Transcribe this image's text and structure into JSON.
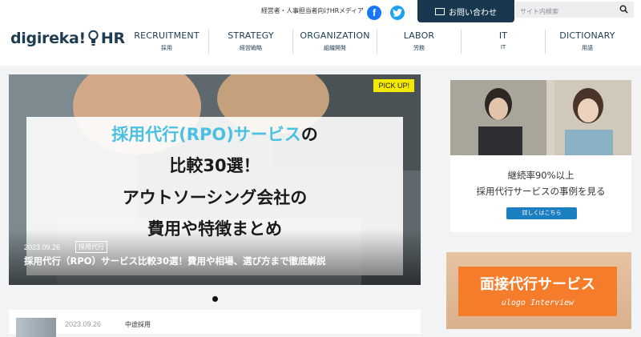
{
  "header": {
    "tagline": "経営者・人事担当者向けHRメディア",
    "facebook_icon": "f",
    "contact_label": "お問い合わせ",
    "search_placeholder": "サイト内検索",
    "logo_left": "digireka!",
    "logo_right": "HR"
  },
  "nav": [
    {
      "en": "RECRUITMENT",
      "jp": "採用"
    },
    {
      "en": "STRATEGY",
      "jp": "経営戦略"
    },
    {
      "en": "ORGANIZATION",
      "jp": "組織開発"
    },
    {
      "en": "LABOR",
      "jp": "労務"
    },
    {
      "en": "IT",
      "jp": "IT"
    },
    {
      "en": "DICTIONARY",
      "jp": "用語"
    }
  ],
  "hero": {
    "badge": "PICK UP!",
    "banner_line1_highlight": "採用代行(RPO)サービス",
    "banner_line1_rest": "の",
    "banner_line2": "比較30選！",
    "banner_line3": "アウトソーシング会社の",
    "banner_line4": "費用や特徴まとめ",
    "date": "2023.09.26",
    "category": "採用代行",
    "title": "採用代行（RPO）サービス比較30選！費用や相場、選び方まで徹底解説"
  },
  "sidebar_promo1": {
    "line1": "継続率90%以上",
    "line2": "採用代行サービスの事例を見る",
    "button": "詳しくはこちら"
  },
  "sidebar_promo2": {
    "title": "面接代行サービス",
    "subtitle": "ulogo Interview"
  },
  "article_card": {
    "date": "2023.09.26",
    "category": "中途採用"
  },
  "colors": {
    "brand_navy": "#1d3c52",
    "contact_bg": "#17384e",
    "pickup_yellow": "#f3e800",
    "highlight_cyan": "#4cc0e0",
    "cta_blue": "#1b7fc1",
    "promo_orange": "#f47c2b"
  }
}
